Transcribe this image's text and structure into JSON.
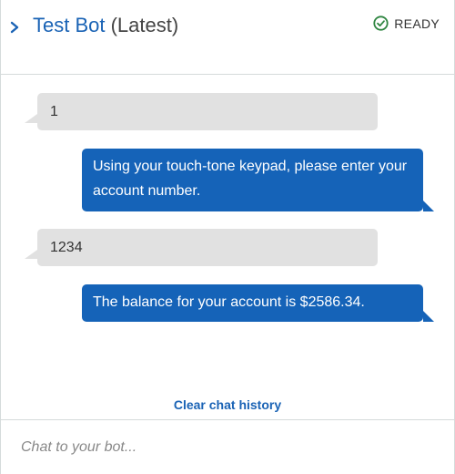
{
  "header": {
    "bot_name": "Test Bot",
    "version_label": "(Latest)",
    "status": "READY",
    "icons": {
      "collapse": "chevron-right-icon",
      "status": "check-circle-icon"
    },
    "colors": {
      "title": "#1a63b5",
      "status_ok": "#2e8540"
    }
  },
  "messages": [
    {
      "role": "user",
      "text": "1"
    },
    {
      "role": "bot",
      "text": "Using your touch-tone keypad, please enter your account number."
    },
    {
      "role": "user",
      "text": "1234"
    },
    {
      "role": "bot",
      "text": "The balance for your account is $2586.34."
    }
  ],
  "actions": {
    "clear_history": "Clear chat history"
  },
  "composer": {
    "placeholder": "Chat to your bot..."
  },
  "colors": {
    "bot_bubble": "#1563b8",
    "user_bubble": "#e1e1e1"
  }
}
